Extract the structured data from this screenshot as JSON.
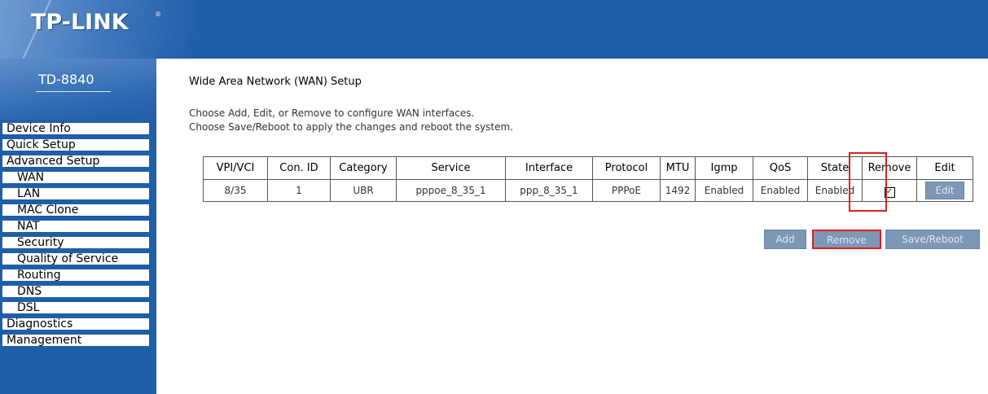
{
  "brand": {
    "logo": "TP-LINK",
    "reg": "®",
    "model": "TD-8840"
  },
  "menu": [
    {
      "label": "Device Info",
      "sub": false
    },
    {
      "label": "Quick Setup",
      "sub": false
    },
    {
      "label": "Advanced Setup",
      "sub": false
    },
    {
      "label": "WAN",
      "sub": true
    },
    {
      "label": "LAN",
      "sub": true
    },
    {
      "label": "MAC Clone",
      "sub": true
    },
    {
      "label": "NAT",
      "sub": true
    },
    {
      "label": "Security",
      "sub": true
    },
    {
      "label": "Quality of Service",
      "sub": true
    },
    {
      "label": "Routing",
      "sub": true
    },
    {
      "label": "DNS",
      "sub": true
    },
    {
      "label": "DSL",
      "sub": true
    },
    {
      "label": "Diagnostics",
      "sub": false
    },
    {
      "label": "Management",
      "sub": false
    }
  ],
  "page": {
    "title": "Wide Area Network (WAN) Setup",
    "desc1": "Choose Add, Edit, or Remove to configure WAN interfaces.",
    "desc2": "Choose Save/Reboot to apply the changes and reboot the system."
  },
  "table": {
    "headers": [
      "VPI/VCI",
      "Con. ID",
      "Category",
      "Service",
      "Interface",
      "Protocol",
      "MTU",
      "Igmp",
      "QoS",
      "State",
      "Remove",
      "Edit"
    ],
    "rows": [
      {
        "vpi_vci": "8/35",
        "con_id": "1",
        "category": "UBR",
        "service": "pppoe_8_35_1",
        "interface": "ppp_8_35_1",
        "protocol": "PPPoE",
        "mtu": "1492",
        "igmp": "Enabled",
        "qos": "Enabled",
        "state": "Enabled",
        "remove_checked": true,
        "edit_label": "Edit"
      }
    ]
  },
  "buttons": {
    "add": "Add",
    "remove": "Remove",
    "save_reboot": "Save/Reboot"
  },
  "colors": {
    "banner": "#1f5ea8",
    "button": "#7d97b6",
    "highlight": "#e01e1e"
  }
}
